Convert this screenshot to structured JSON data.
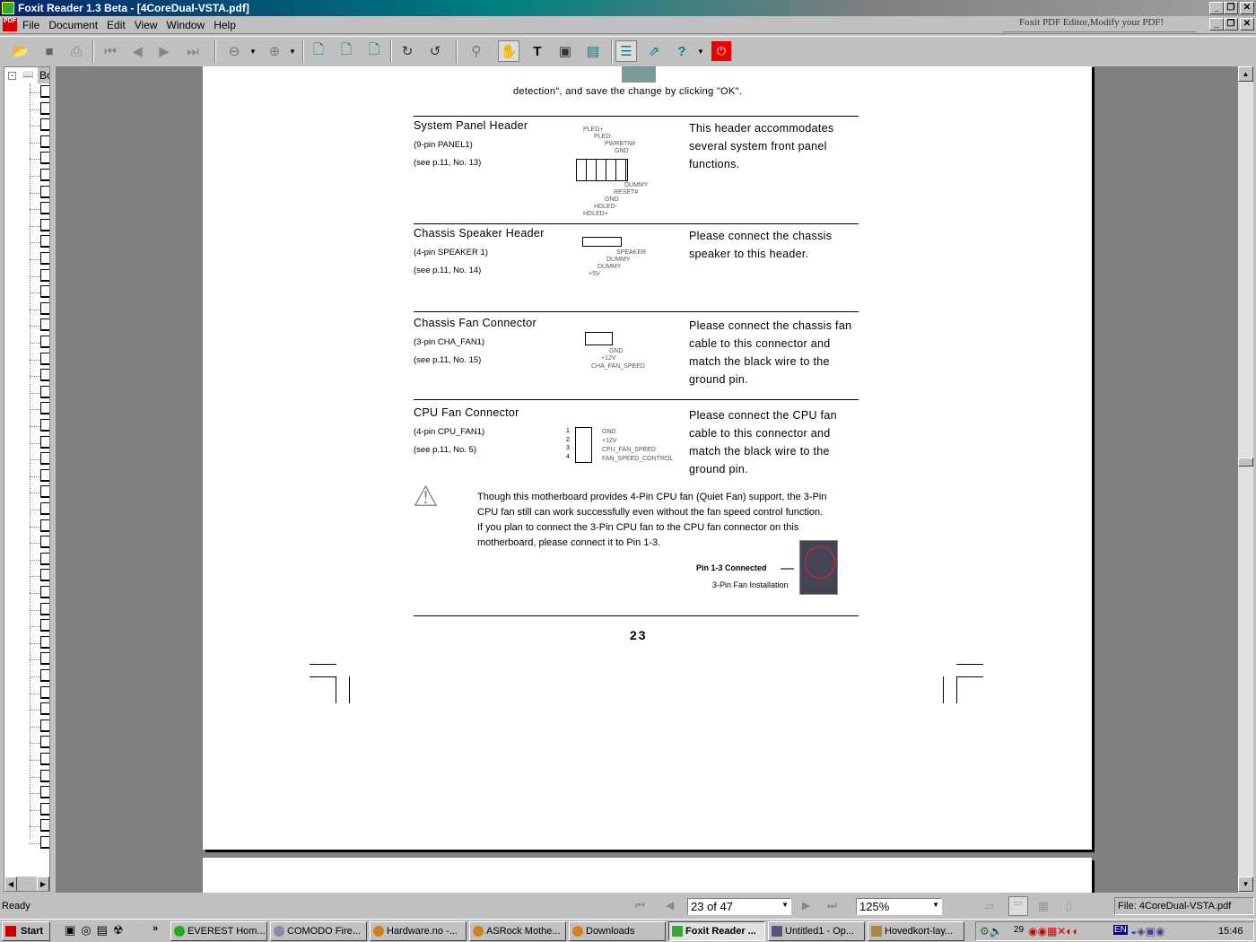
{
  "window": {
    "title": "Foxit Reader 1.3 Beta - [4CoreDual-VSTA.pdf]",
    "ad": "Foxit PDF Editor,Modify your PDF!"
  },
  "menu": [
    "File",
    "Document",
    "Edit",
    "View",
    "Window",
    "Help"
  ],
  "sidebar": {
    "tab": "Bo"
  },
  "page": {
    "intro": "detection\", and save the change by clicking \"OK\".",
    "sections": [
      {
        "title": "System Panel Header",
        "pins": "(9-pin PANEL1)",
        "ref": "(see  p.11, No. 13)",
        "desc": [
          "This header accommodates",
          "several system front panel",
          "functions."
        ],
        "labels": [
          "PLED+",
          "PLED-",
          "PWRBTN#",
          "GND",
          "DUMMY",
          "RESET#",
          "GND",
          "HDLED-",
          "HDLED+"
        ]
      },
      {
        "title": "Chassis Speaker Header",
        "pins": "(4-pin SPEAKER 1)",
        "ref": "(see  p.11, No. 14)",
        "desc": [
          "Please connect the chassis",
          "speaker to this header."
        ],
        "labels": [
          "SPEAKER",
          "DUMMY",
          "DUMMY",
          "+5V"
        ]
      },
      {
        "title": "Chassis Fan Connector",
        "pins": "(3-pin CHA_FAN1)",
        "ref": "(see  p.11, No. 15)",
        "desc": [
          "Please connect the chassis fan",
          "cable to this connector and",
          "match the black wire to the",
          "ground pin."
        ],
        "labels": [
          "GND",
          "+12V",
          "CHA_FAN_SPEED"
        ]
      },
      {
        "title": "CPU Fan Connector",
        "pins": "(4-pin CPU_FAN1)",
        "ref": "(see  p.11,  No. 5)",
        "desc": [
          "Please connect the CPU fan",
          "cable to this connector and",
          "match the black wire to the",
          "ground pin."
        ],
        "labels": [
          "GND",
          "+12V",
          "CPU_FAN_SPEED",
          "FAN_SPEED_CONTROL"
        ],
        "numbers": [
          "1",
          "2",
          "3",
          "4"
        ]
      }
    ],
    "note": [
      "Though this motherboard provides 4-Pin CPU fan (Quiet Fan) support, the 3-Pin",
      "CPU fan still can work successfully even without the fan speed control function.",
      "If you plan to connect the 3-Pin CPU fan to the CPU fan connector on this",
      "motherboard, please connect it to Pin 1-3."
    ],
    "pin_caption": "Pin 1-3 Connected",
    "install_caption": "3-Pin Fan Installation",
    "page_number": "23"
  },
  "status": {
    "text": "Ready",
    "page": "23 of 47",
    "zoom": "125%",
    "file": "File: 4CoreDual-VSTA.pdf"
  },
  "taskbar": {
    "start": "Start",
    "tasks": [
      "EVEREST Hom...",
      "COMODO Fire...",
      "Hardware.no -...",
      "ASRock Mothe...",
      "Downloads",
      "Foxit Reader ...",
      "Untitled1 - Op...",
      "Hovedkort-lay..."
    ],
    "tray_num": "29",
    "lang": "EN",
    "clock": "15:46"
  }
}
